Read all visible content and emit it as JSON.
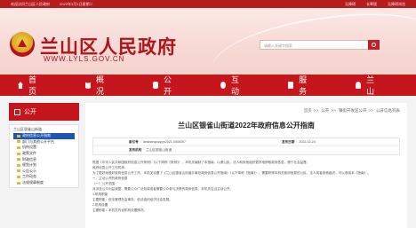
{
  "topbar": {
    "welcome": "欢迎访问兰山区人民政府",
    "date": "2022年3月1日星期二",
    "links": [
      "无障碍",
      "长辈版",
      "无障碍浏览"
    ]
  },
  "header": {
    "site_title": "兰山区人民政府",
    "site_url": "WWW.LYLS.GOV.CN",
    "search_placeholder": "请输入关键字搜索"
  },
  "nav": {
    "items": [
      {
        "label": "首页",
        "icon": "home-icon"
      },
      {
        "label": "概况",
        "icon": "book-icon"
      },
      {
        "label": "公开",
        "icon": "share-icon"
      },
      {
        "label": "互动",
        "icon": "chat-icon"
      },
      {
        "label": "服务",
        "icon": "briefcase-icon"
      },
      {
        "label": "兰山",
        "icon": "people-icon"
      }
    ]
  },
  "sidebar": {
    "heading": "公开",
    "root": "兰山区银雀山街道",
    "items": [
      {
        "label": "政府信息公开指南",
        "active": true
      },
      {
        "label": "部门与其他公开平台",
        "active": false
      },
      {
        "label": "机构设置",
        "active": false
      },
      {
        "label": "政策文件",
        "active": false
      },
      {
        "label": "财政信息",
        "active": false
      },
      {
        "label": "规划计划",
        "active": false
      },
      {
        "label": "公告公示",
        "active": false
      },
      {
        "label": "工作动态",
        "active": false
      },
      {
        "label": "法规规章制度",
        "active": false
      }
    ]
  },
  "content": {
    "breadcrumb": [
      "首页",
      "公开",
      "镇街开发区公开",
      "公开信息列表"
    ],
    "title": "兰山区银雀山街道2022年政府信息公开指南",
    "meta": {
      "index_label": "索引号",
      "index_value": "lanshanquyq/ys2021-0006397",
      "date_label": "发布日期",
      "date_value": "2022-02-24",
      "org_label": "发布机构",
      "org_value": "兰山区银雀山街道"
    },
    "paragraphs": [
      "根据《中华人民共和国政府信息公开条例》（以下简称《条例》），本机关编制了本指南，以便公民、法人和其他组织更好地获取政府信息，便于社会监督。",
      "政府信息公开工作机构",
      "为了更好地做好政府信息公开工作，本机关设置了《兰山区银雀山街道办事处政府信息公开指南》（以下简称《指南》），需要获得本机关政府信息的公民、法人或者其他组织，可以参阅本《指南》。",
      "一、主动公开的政府信息",
      "（一）公开范围",
      "对涉及公众利益调整、需要公众广泛知晓或者需要公众参与决策的政府信息，本机关应当主动公开。",
      "1.机构职能",
      "主要职能：依法管理社会事务、依法组织经济社会发展。",
      "2.机构设置",
      "主要职能：本机关内设机构设置情况。"
    ]
  }
}
